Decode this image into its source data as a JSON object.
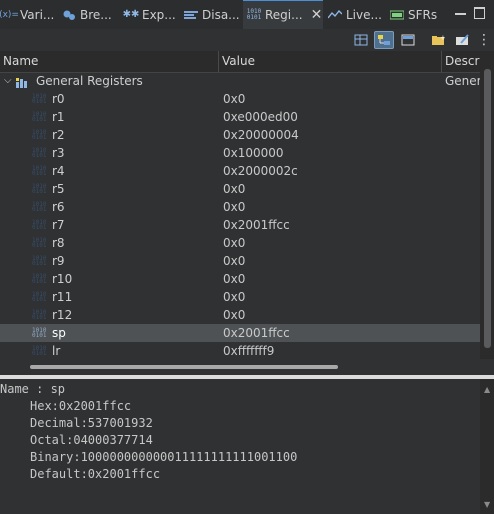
{
  "tabs": [
    {
      "label": "Vari...",
      "icon": "variables-icon"
    },
    {
      "label": "Bre...",
      "icon": "breakpoints-icon"
    },
    {
      "label": "Exp...",
      "icon": "expressions-icon"
    },
    {
      "label": "Disa...",
      "icon": "disassembly-icon"
    },
    {
      "label": "Regi...",
      "icon": "registers-icon",
      "active": true
    },
    {
      "label": "Live...",
      "icon": "live-expressions-icon"
    },
    {
      "label": "SFRs",
      "icon": "sfrs-icon"
    }
  ],
  "columns": {
    "name": "Name",
    "value": "Value",
    "description": "Descrip"
  },
  "group": {
    "name": "General Registers",
    "description": "Genera"
  },
  "registers": [
    {
      "name": "r0",
      "value": "0x0"
    },
    {
      "name": "r1",
      "value": "0xe000ed00"
    },
    {
      "name": "r2",
      "value": "0x20000004"
    },
    {
      "name": "r3",
      "value": "0x100000"
    },
    {
      "name": "r4",
      "value": "0x2000002c"
    },
    {
      "name": "r5",
      "value": "0x0"
    },
    {
      "name": "r6",
      "value": "0x0"
    },
    {
      "name": "r7",
      "value": "0x2001ffcc"
    },
    {
      "name": "r8",
      "value": "0x0"
    },
    {
      "name": "r9",
      "value": "0x0"
    },
    {
      "name": "r10",
      "value": "0x0"
    },
    {
      "name": "r11",
      "value": "0x0"
    },
    {
      "name": "r12",
      "value": "0x0"
    },
    {
      "name": "sp",
      "value": "0x2001ffcc",
      "selected": true
    },
    {
      "name": "lr",
      "value": "0xfffffff9"
    }
  ],
  "detail": {
    "name_line": "Name : sp",
    "hex": "Hex:0x2001ffcc",
    "decimal": "Decimal:537001932",
    "octal": "Octal:04000377714",
    "binary": "Binary:100000000000011111111111001100",
    "default": "Default:0x2001ffcc"
  },
  "icon_glyph": "1010\n0101",
  "colors": {
    "accent": "#4a8fd8",
    "selected_row": "#4e5254",
    "background": "#2f3133"
  }
}
